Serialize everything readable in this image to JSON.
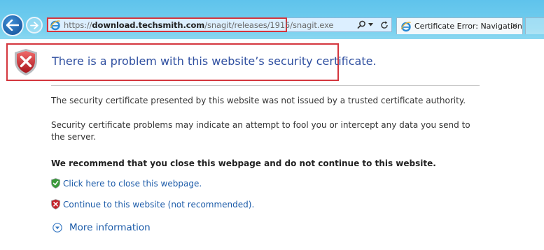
{
  "browser": {
    "address": {
      "scheme": "https://",
      "host": "download.techsmith.com",
      "path": "/snagit/releases/1915/snagit.exe"
    },
    "tab": {
      "title": "Certificate Error: Navigation...",
      "close_label": "✕"
    },
    "icons": {
      "search": "search-icon",
      "dropdown": "chevron-down-icon",
      "refresh": "refresh-icon"
    }
  },
  "page": {
    "title": "There is a problem with this website’s security certificate.",
    "paragraph1": "The security certificate presented by this website was not issued by a trusted certificate authority.",
    "paragraph2": "Security certificate problems may indicate an attempt to fool you or intercept any data you send to the server.",
    "recommendation": "We recommend that you close this webpage and do not continue to this website.",
    "close_link": "Click here to close this webpage.",
    "continue_link": "Continue to this website (not recommended).",
    "more_info": "More information"
  },
  "colors": {
    "accent_red": "#d4363e",
    "title_blue": "#2f4fa0",
    "link_blue": "#1a5aa8",
    "toolbar_blue": "#6ccbee"
  }
}
